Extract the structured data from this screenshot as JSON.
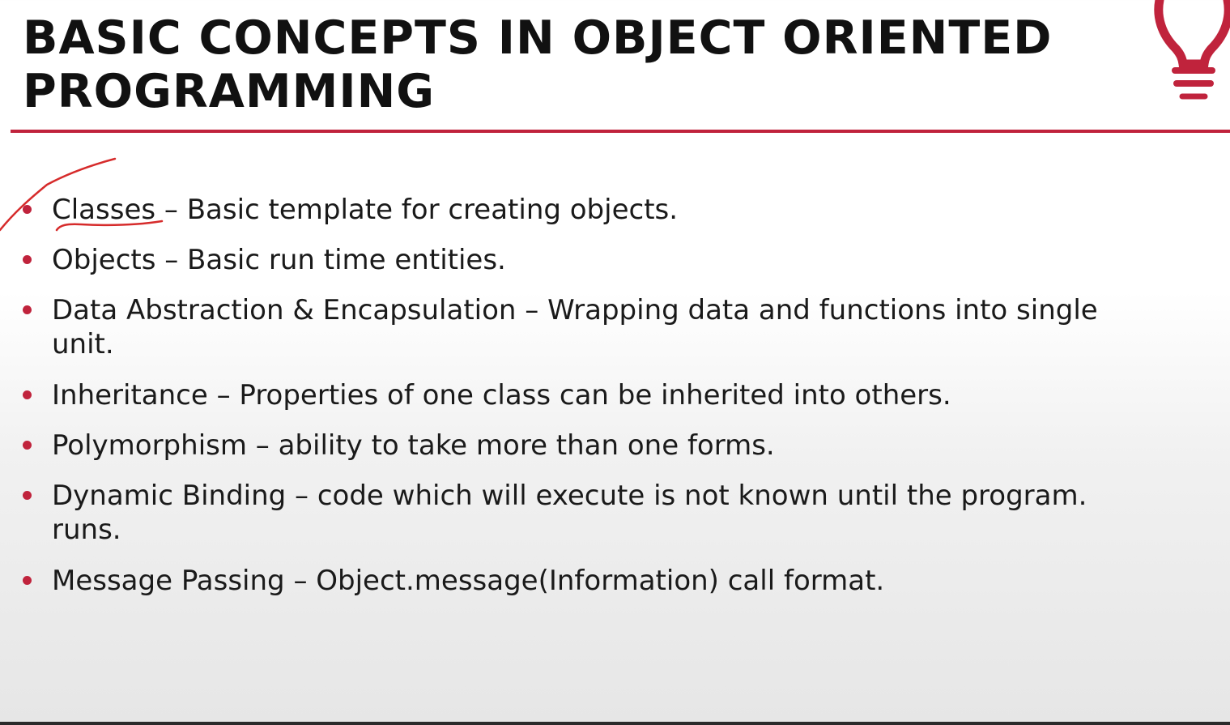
{
  "slide": {
    "title": "BASIC CONCEPTS IN OBJECT ORIENTED PROGRAMMING",
    "accent_color": "#c0233c",
    "header_icon": "lightbulb-icon"
  },
  "bullets": [
    {
      "text": "Classes – Basic template for creating objects."
    },
    {
      "text": "Objects – Basic run time entities."
    },
    {
      "text": "Data Abstraction & Encapsulation – Wrapping data and functions into single\nunit."
    },
    {
      "text": "Inheritance – Properties of one class can be inherited into others."
    },
    {
      "text": "Polymorphism – ability to take more than one forms."
    },
    {
      "text": "Dynamic Binding – code which will execute is not known until the program.\nruns."
    },
    {
      "text": "Message Passing – Object.message(Information) call format."
    }
  ],
  "annotations": {
    "pen_color": "#d62b2b",
    "marks": [
      "checkmark-stroke",
      "underline-stroke"
    ]
  }
}
